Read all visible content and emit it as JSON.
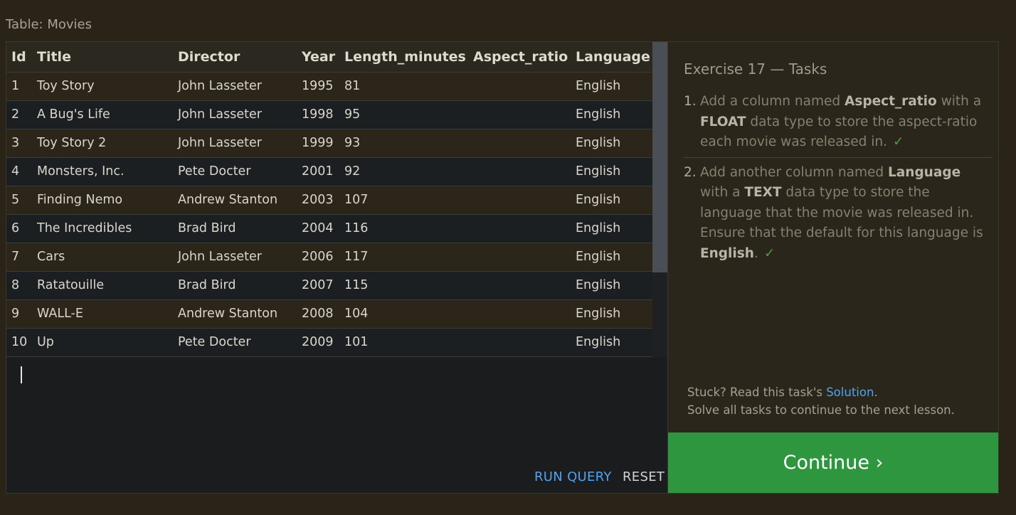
{
  "caption": "Table: Movies",
  "table": {
    "columns": [
      "Id",
      "Title",
      "Director",
      "Year",
      "Length_minutes",
      "Aspect_ratio",
      "Language"
    ],
    "rows": [
      [
        "1",
        "Toy Story",
        "John Lasseter",
        "1995",
        "81",
        "",
        "English"
      ],
      [
        "2",
        "A Bug's Life",
        "John Lasseter",
        "1998",
        "95",
        "",
        "English"
      ],
      [
        "3",
        "Toy Story 2",
        "John Lasseter",
        "1999",
        "93",
        "",
        "English"
      ],
      [
        "4",
        "Monsters, Inc.",
        "Pete Docter",
        "2001",
        "92",
        "",
        "English"
      ],
      [
        "5",
        "Finding Nemo",
        "Andrew Stanton",
        "2003",
        "107",
        "",
        "English"
      ],
      [
        "6",
        "The Incredibles",
        "Brad Bird",
        "2004",
        "116",
        "",
        "English"
      ],
      [
        "7",
        "Cars",
        "John Lasseter",
        "2006",
        "117",
        "",
        "English"
      ],
      [
        "8",
        "Ratatouille",
        "Brad Bird",
        "2007",
        "115",
        "",
        "English"
      ],
      [
        "9",
        "WALL-E",
        "Andrew Stanton",
        "2008",
        "104",
        "",
        "English"
      ],
      [
        "10",
        "Up",
        "Pete Docter",
        "2009",
        "101",
        "",
        "English"
      ]
    ]
  },
  "editor": {
    "run_query_label": "RUN QUERY",
    "reset_label": "RESET"
  },
  "exercise": {
    "title": "Exercise 17 — Tasks",
    "tasks": [
      {
        "num": "1.",
        "p1": "Add a column named ",
        "b1": "Aspect_ratio",
        "p2": " with a ",
        "b2": "FLOAT",
        "p3": " data type to store the aspect-ratio each movie was released in.",
        "b3": "",
        "p4": "",
        "check": "✓"
      },
      {
        "num": "2.",
        "p1": "Add another column named ",
        "b1": "Language",
        "p2": " with a ",
        "b2": "TEXT",
        "p3": " data type to store the language that the movie was released in. Ensure that the default for this language is ",
        "b3": "English",
        "p4": ".",
        "check": "✓"
      }
    ],
    "hint_prefix": "Stuck? Read this task's ",
    "hint_link": "Solution",
    "hint_suffix": ".",
    "hint_line2": "Solve all tasks to continue to the next lesson.",
    "continue_label": "Continue ›"
  },
  "colors": {
    "background": "#2a2418",
    "link": "#4ea3f5",
    "continue": "#2e963e",
    "check": "#4a9a4a"
  }
}
